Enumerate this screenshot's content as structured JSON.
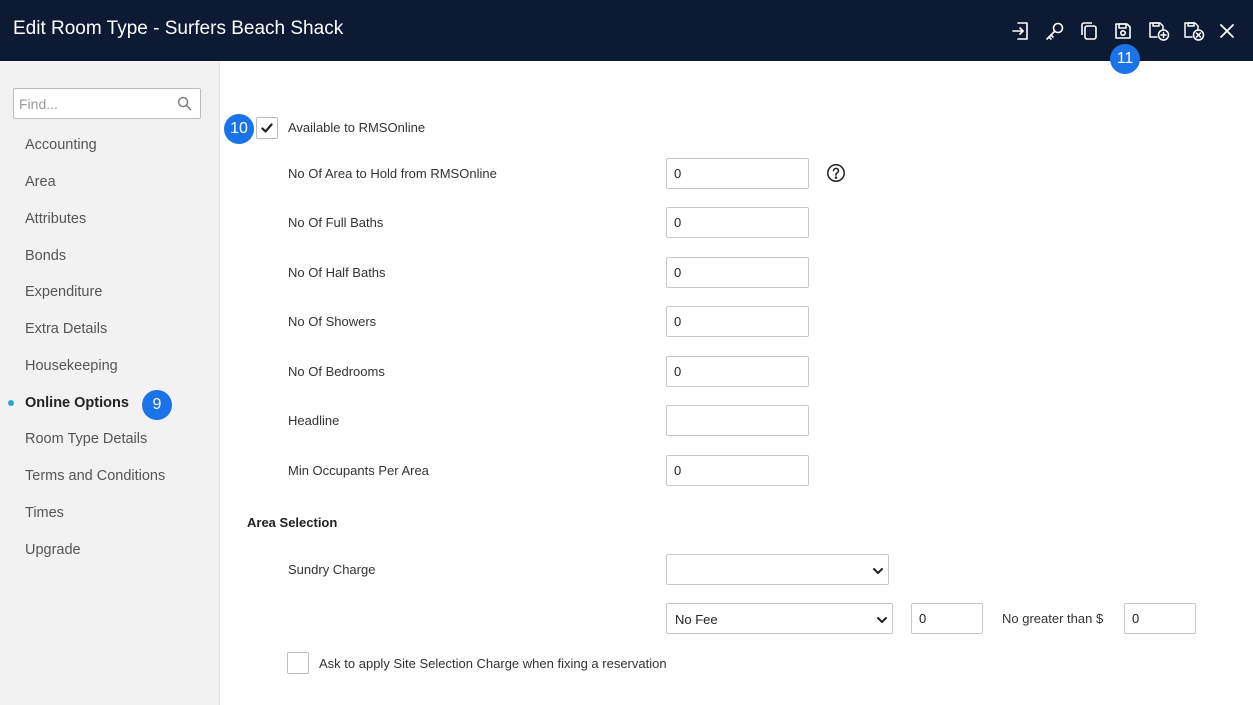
{
  "window": {
    "title": "Edit Room Type - Surfers Beach Shack",
    "toolbar_icons": [
      "import-icon",
      "key-icon",
      "copy-icon",
      "save-icon",
      "save-and-add-icon",
      "save-and-close-icon",
      "close-icon"
    ]
  },
  "badges": {
    "sidebar": "9",
    "checkbox": "10",
    "toolbar": "11"
  },
  "sidebar": {
    "search_placeholder": "Find...",
    "items": [
      {
        "label": "Accounting"
      },
      {
        "label": "Area"
      },
      {
        "label": "Attributes"
      },
      {
        "label": "Bonds"
      },
      {
        "label": "Expenditure"
      },
      {
        "label": "Extra Details"
      },
      {
        "label": "Housekeeping"
      },
      {
        "label": "Online Options",
        "active": true
      },
      {
        "label": "Room Type Details"
      },
      {
        "label": "Terms and Conditions"
      },
      {
        "label": "Times"
      },
      {
        "label": "Upgrade"
      }
    ]
  },
  "form": {
    "available_label": "Available to RMSOnline",
    "available_checked": true,
    "fields": [
      {
        "label": "No Of Area to Hold from RMSOnline",
        "value": "0"
      },
      {
        "label": "No Of Full Baths",
        "value": "0"
      },
      {
        "label": "No Of Half Baths",
        "value": "0"
      },
      {
        "label": "No Of Showers",
        "value": "0"
      },
      {
        "label": "No Of Bedrooms",
        "value": "0"
      },
      {
        "label": "Headline",
        "value": ""
      },
      {
        "label": "Min Occupants Per Area",
        "value": "0"
      }
    ],
    "area_selection_title": "Area Selection",
    "sundry_charge_label": "Sundry Charge",
    "sundry_charge_value": "",
    "fee_type_value": "No Fee",
    "fee_amount": "0",
    "no_greater_than_label": "No greater than $",
    "no_greater_than_value": "0",
    "ask_site_selection_label": "Ask to apply Site Selection Charge when fixing a reservation",
    "ask_site_selection_checked": false
  },
  "colors": {
    "titlebar": "#0c1b33",
    "badge": "#1a73e8",
    "active_dot": "#2aa7c9"
  }
}
